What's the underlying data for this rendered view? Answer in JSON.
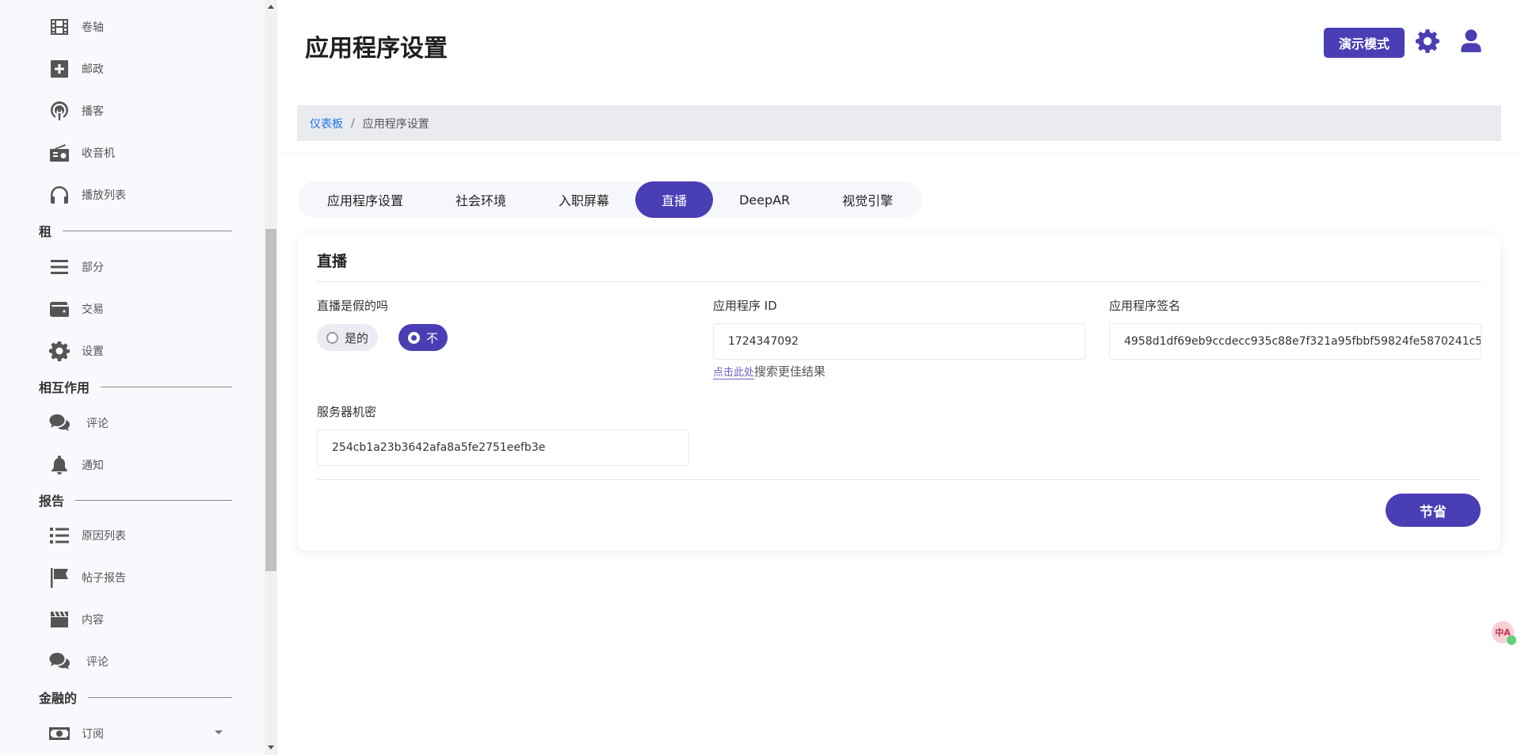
{
  "sidebar": {
    "items": [
      {
        "label": "卷轴",
        "icon": "film-icon"
      },
      {
        "label": "邮政",
        "icon": "plus-square-icon"
      },
      {
        "label": "播客",
        "icon": "podcast-icon"
      },
      {
        "label": "收音机",
        "icon": "radio-icon"
      },
      {
        "label": "播放列表",
        "icon": "headphones-icon"
      },
      {
        "label": "部分",
        "icon": "bars-icon"
      },
      {
        "label": "交易",
        "icon": "wallet-icon"
      },
      {
        "label": "设置",
        "icon": "gear-icon"
      },
      {
        "label": "评论",
        "icon": "comments-icon"
      },
      {
        "label": "通知",
        "icon": "bell-icon"
      },
      {
        "label": "原因列表",
        "icon": "list-icon"
      },
      {
        "label": "帖子报告",
        "icon": "flag-icon"
      },
      {
        "label": "内容",
        "icon": "clapperboard-icon"
      },
      {
        "label": "评论",
        "icon": "comments-icon"
      },
      {
        "label": "订阅",
        "icon": "money-bill-icon"
      }
    ],
    "sections": [
      "租",
      "相互作用",
      "报告",
      "金融的"
    ]
  },
  "header": {
    "title": "应用程序设置",
    "demo_label": "演示模式"
  },
  "breadcrumb": {
    "home": "仪表板",
    "separator": "/",
    "current": "应用程序设置"
  },
  "tabs": [
    "应用程序设置",
    "社会环境",
    "入职屏幕",
    "直播",
    "DeepAR",
    "视觉引擎"
  ],
  "active_tab": "直播",
  "card": {
    "title": "直播",
    "fake_label": "直播是假的吗",
    "radio_yes": "是的",
    "radio_no": "不",
    "app_id_label": "应用程序 ID",
    "app_id_value": "1724347092",
    "hint_link": "点击此处",
    "hint_text": "搜索更佳结果",
    "app_sign_label": "应用程序签名",
    "app_sign_value": "4958d1df69eb9ccdecc935c88e7f321a95fbbf59824fe5870241c5",
    "server_secret_label": "服务器机密",
    "server_secret_value": "254cb1a23b3642afa8a5fe2751eefb3e",
    "save_label": "节省"
  },
  "translate_widget": {
    "text": "中A"
  },
  "colors": {
    "accent": "#4a3eb5",
    "link": "#1a73e8"
  }
}
